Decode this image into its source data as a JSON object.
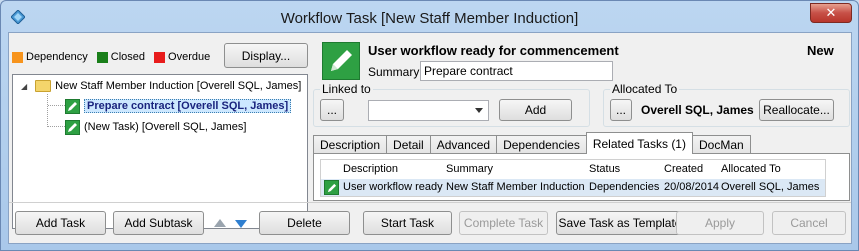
{
  "window": {
    "title": "Workflow Task  [New Staff Member Induction]",
    "close_glyph": "✕"
  },
  "legend": [
    {
      "label": "Dependency",
      "color": "#f7941d"
    },
    {
      "label": "Closed",
      "color": "#1a7f1a"
    },
    {
      "label": "Overdue",
      "color": "#e81c1c"
    }
  ],
  "display_button": "Display...",
  "tree": {
    "root": "New Staff Member Induction [Overell SQL, James]",
    "children": [
      "Prepare contract [Overell SQL, James]",
      "(New Task) [Overell SQL, James]"
    ],
    "expander": "◢"
  },
  "header": {
    "headline": "User workflow ready for commencement",
    "status": "New",
    "summary_label": "Summary:",
    "summary_value": "Prepare contract"
  },
  "linked_to": {
    "label": "Linked to",
    "ellipsis": "...",
    "combo_value": "",
    "add_button": "Add"
  },
  "allocated_to": {
    "label": "Allocated To",
    "ellipsis": "...",
    "name": "Overell SQL, James",
    "reallocate_button": "Reallocate..."
  },
  "tabs": [
    "Description",
    "Detail",
    "Advanced",
    "Dependencies",
    "Related Tasks (1)",
    "DocMan"
  ],
  "active_tab": "Related Tasks (1)",
  "related_tasks": {
    "columns": [
      "Description",
      "Summary",
      "Status",
      "Created",
      "Allocated To"
    ],
    "rows": [
      [
        "User workflow ready",
        "New Staff Member Induction",
        "Dependencies",
        "20/08/2014",
        "Overell SQL, James"
      ]
    ]
  },
  "buttons": {
    "add_task": "Add Task",
    "add_subtask": "Add Subtask",
    "delete": "Delete",
    "start_task": "Start Task",
    "complete_task": "Complete Task",
    "save_template": "Save Task as Template",
    "apply": "Apply",
    "cancel": "Cancel"
  },
  "icons": {
    "app": "diamond-app-icon",
    "check": "green-pencil-check-icon",
    "folder": "folder-icon",
    "up": "move-up-arrow-icon",
    "down": "move-down-arrow-icon"
  }
}
